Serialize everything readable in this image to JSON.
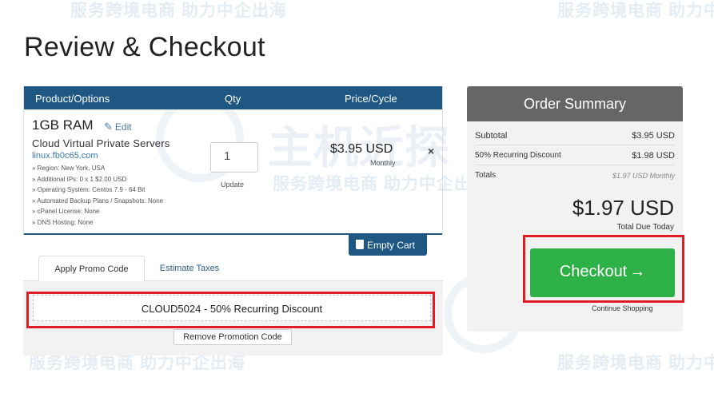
{
  "watermark": {
    "text": "服务跨境电商 助力中企出海",
    "logo_text": "主机近探"
  },
  "page": {
    "title": "Review & Checkout"
  },
  "cart": {
    "columns": {
      "product": "Product/Options",
      "qty": "Qty",
      "price": "Price/Cycle"
    },
    "item": {
      "name": "1GB RAM",
      "edit_label": "Edit",
      "group": "Cloud Virtual Private Servers",
      "domain": "linux.fb0c65.com",
      "options": [
        "» Region: New York, USA",
        "» Additional IPs: 0 x 1 $2.00 USD",
        "» Operating System: Centos 7.9 - 64 Bit",
        "» Automated Backup Plans / Snapshots: None",
        "» cPanel License: None",
        "» DNS Hosting: None"
      ],
      "qty": "1",
      "update_label": "Update",
      "price": "$3.95 USD",
      "cycle": "Monthly",
      "remove_symbol": "×"
    },
    "empty_cart_label": "Empty Cart"
  },
  "tabs": {
    "promo": "Apply Promo Code",
    "taxes": "Estimate Taxes"
  },
  "promo": {
    "applied": "CLOUD5024 - 50% Recurring Discount",
    "remove_label": "Remove Promotion Code"
  },
  "summary": {
    "title": "Order Summary",
    "subtotal_label": "Subtotal",
    "subtotal_value": "$3.95 USD",
    "discount_label": "50% Recurring Discount",
    "discount_value": "$1.98 USD",
    "totals_label": "Totals",
    "totals_value": "$1.97 USD Monthly",
    "total_due": "$1.97 USD",
    "total_due_label": "Total Due Today",
    "checkout_label": "Checkout",
    "checkout_arrow": "→",
    "continue_label": "Continue Shopping"
  },
  "colors": {
    "header_blue": "#1e5782",
    "checkout_green": "#2db045",
    "highlight_red": "#e01c24",
    "summary_header": "#666666"
  }
}
